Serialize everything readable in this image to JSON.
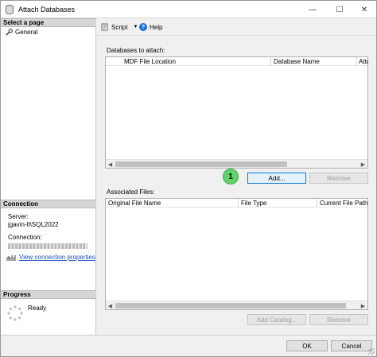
{
  "window": {
    "title": "Attach Databases",
    "minimize_glyph": "—",
    "maximize_glyph": "☐",
    "close_glyph": "✕"
  },
  "left": {
    "select_page_header": "Select a page",
    "pages": [
      {
        "label": "General",
        "icon": "wrench-icon"
      }
    ],
    "connection_header": "Connection",
    "server_label": "Server:",
    "server_value": "jgavin-lt\\SQL2022",
    "connection_label": "Connection:",
    "view_connection_link": "View connection properties",
    "progress_header": "Progress",
    "progress_status": "Ready"
  },
  "toolbar": {
    "script_label": "Script",
    "script_dropdown": "▼",
    "help_label": "Help",
    "help_glyph": "?"
  },
  "databases": {
    "group_label": "Databases to attach:",
    "columns": [
      "MDF File Location",
      "Database Name",
      "Atta"
    ],
    "rows": [],
    "scroll_left": "◀",
    "scroll_right": "▶",
    "add_button": "Add...",
    "remove_button": "Remove"
  },
  "associated": {
    "group_label": "Associated Files:",
    "columns": [
      "Original File Name",
      "File Type",
      "Current File Path"
    ],
    "rows": [],
    "scroll_left": "◀",
    "scroll_right": "▶",
    "add_catalog_button": "Add Catalog...",
    "remove_button": "Remove"
  },
  "annotation_badge": "1",
  "footer": {
    "ok_button": "OK",
    "cancel_button": "Cancel"
  },
  "colors": {
    "accent": "#0078d7",
    "link": "#1a4fbf",
    "badge": "#5fd36a"
  }
}
